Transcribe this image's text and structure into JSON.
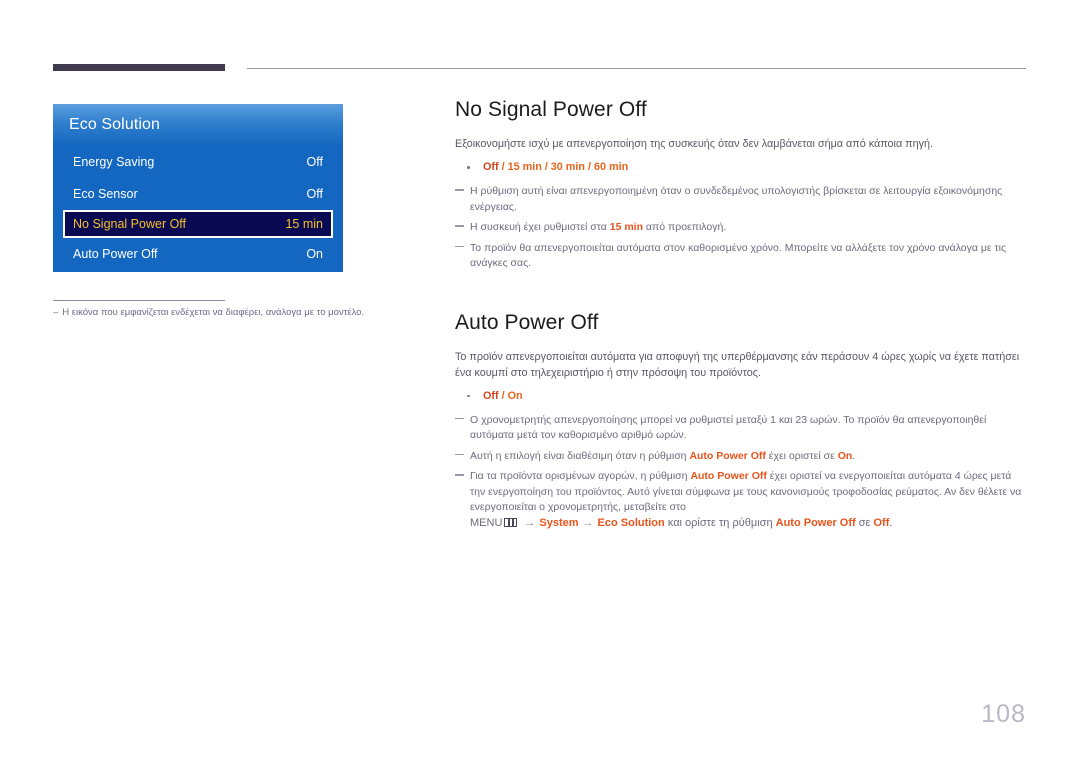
{
  "page": {
    "number": "108"
  },
  "osd": {
    "title": "Eco Solution",
    "rows": [
      {
        "label": "Energy Saving",
        "value": "Off",
        "selected": false
      },
      {
        "label": "Eco Sensor",
        "value": "Off",
        "selected": false
      },
      {
        "label": "No Signal Power Off",
        "value": "15 min",
        "selected": true
      },
      {
        "label": "Auto Power Off",
        "value": "On",
        "selected": false
      }
    ],
    "footnote_dash": "–",
    "footnote": "Η εικόνα που εμφανίζεται ενδέχεται να διαφέρει, ανάλογα με το μοντέλο."
  },
  "sections": [
    {
      "title": "No Signal Power Off",
      "intro": "Εξοικονομήστε ισχύ με απενεργοποίηση της συσκευής όταν δεν λαμβάνεται σήμα από κάποια πηγή.",
      "option": {
        "primary": "Off",
        "rest": " / 15 min / 30 min / 60 min"
      },
      "notes": [
        "Η ρύθμιση αυτή είναι απενεργοποιημένη όταν ο συνδεδεμένος υπολογιστής βρίσκεται σε λειτουργία εξοικονόμησης ενέργειας.",
        "Η συσκευή έχει ρυθμιστεί στα 15 min από προεπιλογή.",
        "Το προϊόν θα απενεργοποιείται αυτόματα στον καθορισμένο χρόνο. Μπορείτε να αλλάξετε τον χρόνο ανάλογα με τις ανάγκες σας."
      ],
      "note2_parts": {
        "a": "Η συσκευή έχει ρυθμιστεί στα ",
        "hl": "15 min",
        "b": " από προεπιλογή."
      }
    },
    {
      "title": "Auto Power Off",
      "intro": "Το προϊόν απενεργοποιείται αυτόματα για αποφυγή της υπερθέρμανσης εάν περάσουν 4 ώρες χωρίς να έχετε πατήσει ένα κουμπί στο τηλεχειριστήριο ή στην πρόσοψη του προϊόντος.",
      "option": {
        "primary": "Off",
        "rest": " / On"
      },
      "notes": [
        "Ο χρονομετρητής απενεργοποίησης μπορεί να ρυθμιστεί μεταξύ 1 και 23 ωρών. Το προϊόν θα απενεργοποιηθεί αυτόματα μετά τον καθορισμένο αριθμό ωρών.",
        "Αυτή η επιλογή είναι διαθέσιμη όταν η ρύθμιση Auto Power Off έχει οριστεί σε On.",
        "Για τα προϊόντα ορισμένων αγορών, η ρύθμιση Auto Power Off έχει οριστεί να ενεργοποιείται αυτόματα 4 ώρες μετά την ενεργοποίηση του προϊόντος. Αυτό γίνεται σύμφωνα με τους κανονισμούς τροφοδοσίας ρεύματος. Αν δεν θέλετε να ενεργοποιείται ο χρονομετρητής, μεταβείτε στο"
      ],
      "note2_parts": {
        "a": "Αυτή η επιλογή είναι διαθέσιμη όταν η ρύθμιση ",
        "hl1": "Auto Power Off",
        "b": " έχει οριστεί σε ",
        "hl2": "On",
        "c": "."
      },
      "note3_parts": {
        "a": "Για τα προϊόντα ορισμένων αγορών, η ρύθμιση ",
        "hl1": "Auto Power Off",
        "b": " έχει οριστεί να ενεργοποιείται αυτόματα 4 ώρες μετά την ενεργοποίηση του προϊόντος. Αυτό γίνεται σύμφωνα με τους κανονισμούς τροφοδοσίας ρεύματος. Αν δεν θέλετε να ενεργοποιείται ο χρονομετρητής, μεταβείτε στο"
      },
      "menu_path": {
        "menu_label": "MENU",
        "icon": "menu-grid-icon",
        "arrow": "→",
        "item1": "System",
        "item2": "Eco Solution",
        "tail_a": "και ορίστε τη ρύθμιση ",
        "tail_hl": "Auto Power Off",
        "tail_b": " σε ",
        "tail_hl2": "Off",
        "tail_c": "."
      }
    }
  ],
  "colors": {
    "osd_blue": "#1467c0",
    "osd_selected_bg": "#090a52",
    "osd_selected_text": "#f5c02a",
    "accent_orange": "#e8541c",
    "header_bar": "#3f3a4d",
    "body_text": "#595767"
  }
}
